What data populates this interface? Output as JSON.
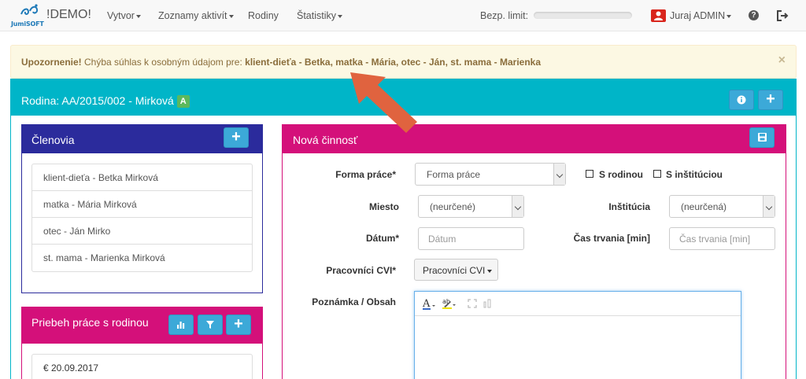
{
  "navbar": {
    "logo_text": "JumiSOFT",
    "brand": "!DEMO!",
    "menu": [
      {
        "label": "Vytvor",
        "dropdown": true
      },
      {
        "label": "Zoznamy aktivít",
        "dropdown": true
      },
      {
        "label": "Rodiny",
        "dropdown": false
      },
      {
        "label": "Štatistiky",
        "dropdown": true
      }
    ],
    "limit_label": "Bezp. limit:",
    "user_name": "Juraj ADMIN",
    "icons": {
      "user": "user-icon",
      "help": "question-circle-icon",
      "logout": "sign-out-icon"
    }
  },
  "alert": {
    "strong": "Upozornenie!",
    "message": "Chýba súhlas k osobným údajom pre:",
    "members": "klient-dieťa - Betka, matka - Mária, otec - Ján, st. mama - Marienka",
    "close": "×"
  },
  "family": {
    "title": "Rodina: AA/2015/002 - Mirková",
    "badge": "A"
  },
  "members_panel": {
    "title": "Členovia",
    "items": [
      "klient-dieťa - Betka Mirková",
      "matka - Mária Mirková",
      "otec - Ján Mirko",
      "st. mama - Marienka Mirková"
    ]
  },
  "progress_panel": {
    "title": "Priebeh práce s rodinou",
    "first_entry": "€ 20.09.2017"
  },
  "activity_panel": {
    "title": "Nová činnosť",
    "forma_label": "Forma práce*",
    "forma_value": "Forma práce",
    "s_rodinou": "S rodinou",
    "s_institucion": "S inštitúciou",
    "miesto_label": "Miesto",
    "miesto_value": "(neurčené)",
    "institucia_label": "Inštitúcia",
    "institucia_value": "(neurčená)",
    "datum_label": "Dátum*",
    "datum_placeholder": "Dátum",
    "cas_label": "Čas trvania [min]",
    "cas_placeholder": "Čas trvania [min]",
    "pracovnici_label": "Pracovníci CVI*",
    "pracovnici_button": "Pracovníci CVI",
    "poznamka_label": "Poznámka / Obsah"
  },
  "colors": {
    "teal": "#00b5c8",
    "navy": "#2b2b9c",
    "magenta": "#d4107a",
    "button_blue": "#3ca9d8",
    "alert_bg": "#fcf8e3",
    "arrow": "#e0633f"
  }
}
